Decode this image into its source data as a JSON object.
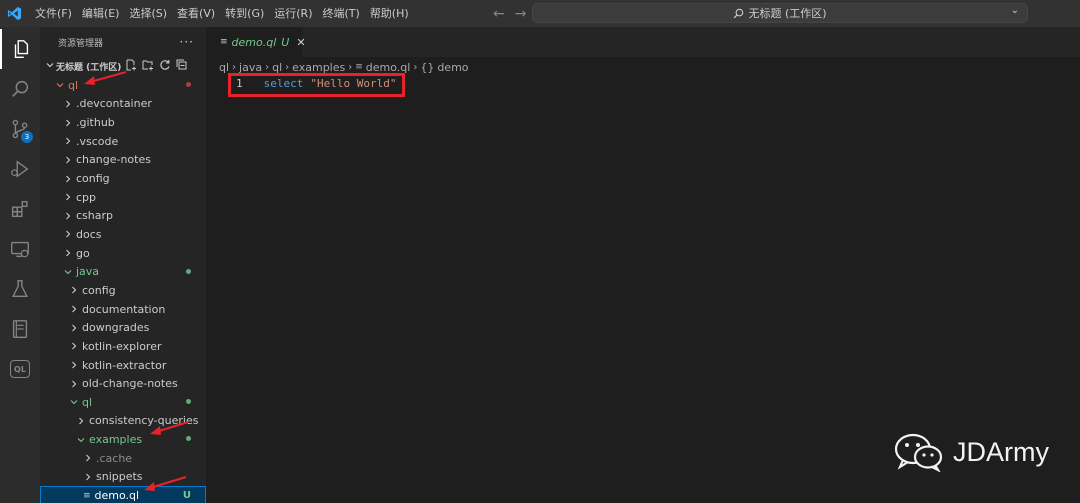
{
  "titlebar": {
    "menu": [
      "文件(F)",
      "编辑(E)",
      "选择(S)",
      "查看(V)",
      "转到(G)",
      "运行(R)",
      "终端(T)",
      "帮助(H)"
    ],
    "search_text": "无标题 (工作区)"
  },
  "activity": {
    "scm_badge": "3",
    "ql_label": "QL"
  },
  "sidebar": {
    "title": "资源管理器",
    "more": "···",
    "workspace": "无标题 (工作区)",
    "tree": [
      {
        "label": "ql",
        "expanded": true,
        "color": "git-modified",
        "depth": 0
      },
      {
        "label": ".devcontainer",
        "expanded": false,
        "depth": 1
      },
      {
        "label": ".github",
        "expanded": false,
        "depth": 1
      },
      {
        "label": ".vscode",
        "expanded": false,
        "depth": 1
      },
      {
        "label": "change-notes",
        "expanded": false,
        "depth": 1
      },
      {
        "label": "config",
        "expanded": false,
        "depth": 1
      },
      {
        "label": "cpp",
        "expanded": false,
        "depth": 1
      },
      {
        "label": "csharp",
        "expanded": false,
        "depth": 1
      },
      {
        "label": "docs",
        "expanded": false,
        "depth": 1
      },
      {
        "label": "go",
        "expanded": false,
        "depth": 1
      },
      {
        "label": "java",
        "expanded": true,
        "color": "git-untracked",
        "depth": 1
      },
      {
        "label": "config",
        "expanded": false,
        "depth": 2
      },
      {
        "label": "documentation",
        "expanded": false,
        "depth": 2
      },
      {
        "label": "downgrades",
        "expanded": false,
        "depth": 2
      },
      {
        "label": "kotlin-explorer",
        "expanded": false,
        "depth": 2
      },
      {
        "label": "kotlin-extractor",
        "expanded": false,
        "depth": 2
      },
      {
        "label": "old-change-notes",
        "expanded": false,
        "depth": 2
      },
      {
        "label": "ql",
        "expanded": true,
        "color": "git-untracked",
        "depth": 2
      },
      {
        "label": "consistency-queries",
        "expanded": false,
        "depth": 3
      },
      {
        "label": "examples",
        "expanded": true,
        "color": "git-untracked",
        "depth": 3
      },
      {
        "label": ".cache",
        "expanded": false,
        "dim": true,
        "depth": 4
      },
      {
        "label": "snippets",
        "expanded": false,
        "depth": 4
      },
      {
        "label": "demo.ql",
        "file": true,
        "selected": true,
        "badge": "U",
        "depth": 4
      }
    ]
  },
  "editor": {
    "tab_name": "demo.ql",
    "tab_status": "U",
    "breadcrumb": [
      "ql",
      "java",
      "ql",
      "examples",
      "demo.ql",
      "demo"
    ],
    "line_number": "1",
    "code_keyword": "select",
    "code_string": "\"Hello World\""
  },
  "watermark": {
    "text": "JDArmy"
  },
  "colors": {
    "accent": "#007fd4",
    "git_untracked": "#73c991",
    "annotation": "#e8222a"
  }
}
